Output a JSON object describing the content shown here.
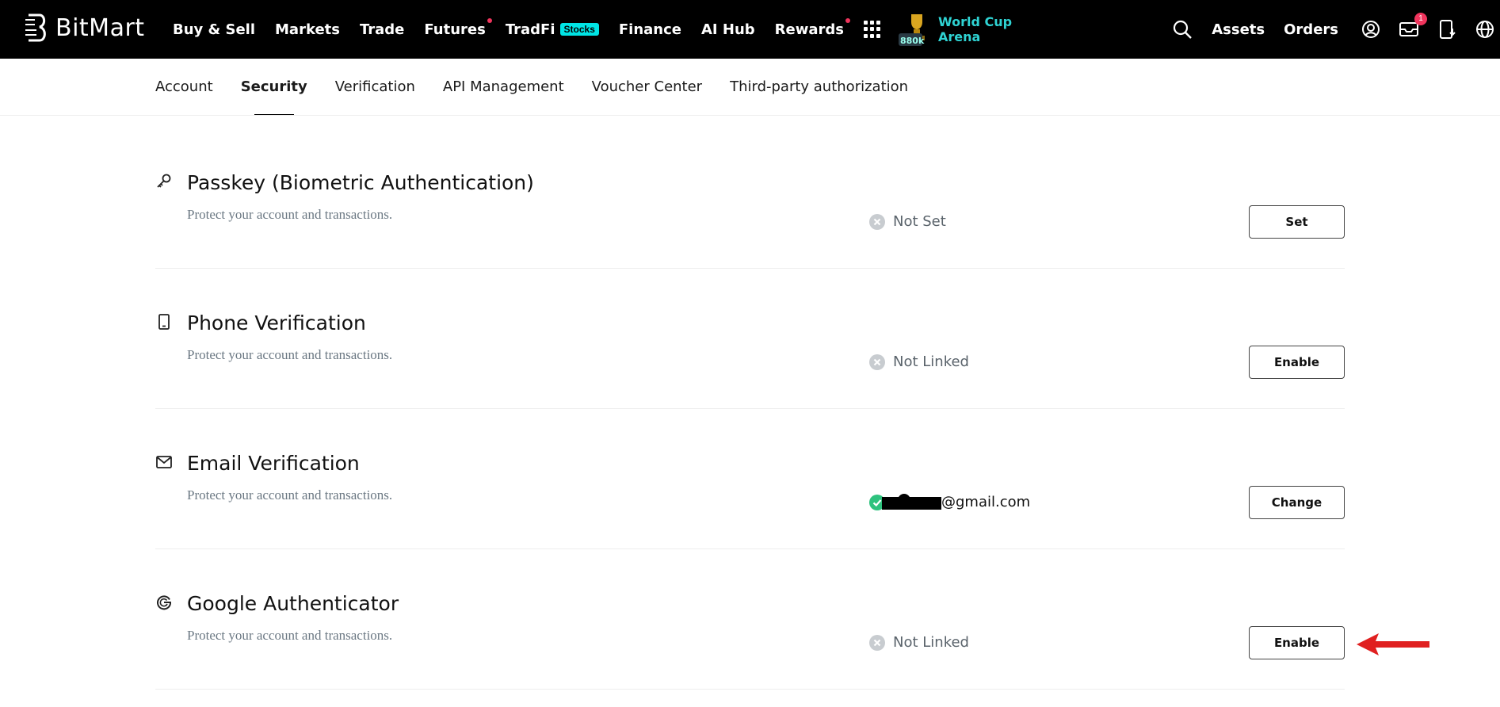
{
  "brand": {
    "name": "BitMart"
  },
  "nav": {
    "items": [
      {
        "label": "Buy & Sell",
        "dot": false
      },
      {
        "label": "Markets",
        "dot": false
      },
      {
        "label": "Trade",
        "dot": false
      },
      {
        "label": "Futures",
        "dot": true
      },
      {
        "label": "TradFi",
        "dot": false,
        "badge": "Stocks"
      },
      {
        "label": "Finance",
        "dot": false
      },
      {
        "label": "AI Hub",
        "dot": false
      },
      {
        "label": "Rewards",
        "dot": true
      }
    ],
    "promo": {
      "line1": "World Cup",
      "line2": "Arena",
      "img_text": "880k"
    },
    "right": {
      "assets": "Assets",
      "orders": "Orders",
      "notification_count": "1"
    }
  },
  "subtabs": [
    {
      "label": "Account",
      "active": false
    },
    {
      "label": "Security",
      "active": true
    },
    {
      "label": "Verification",
      "active": false
    },
    {
      "label": "API Management",
      "active": false
    },
    {
      "label": "Voucher Center",
      "active": false
    },
    {
      "label": "Third-party authorization",
      "active": false
    }
  ],
  "security": {
    "rows": [
      {
        "icon": "key-icon",
        "title": "Passkey (Biometric Authentication)",
        "desc": "Protect your account and transactions.",
        "status": "Not Set",
        "status_ok": false,
        "button": "Set"
      },
      {
        "icon": "phone-icon",
        "title": "Phone Verification",
        "desc": "Protect your account and transactions.",
        "status": "Not Linked",
        "status_ok": false,
        "button": "Enable"
      },
      {
        "icon": "mail-icon",
        "title": "Email Verification",
        "desc": "Protect your account and transactions.",
        "status": "@gmail.com",
        "status_ok": true,
        "button": "Change"
      },
      {
        "icon": "google-icon",
        "title": "Google Authenticator",
        "desc": "Protect your account and transactions.",
        "status": "Not Linked",
        "status_ok": false,
        "button": "Enable"
      }
    ]
  },
  "colors": {
    "accent": "#00e5e5",
    "alert": "#f0355d",
    "success": "#2ec27e",
    "annotation_arrow": "#e02020"
  }
}
